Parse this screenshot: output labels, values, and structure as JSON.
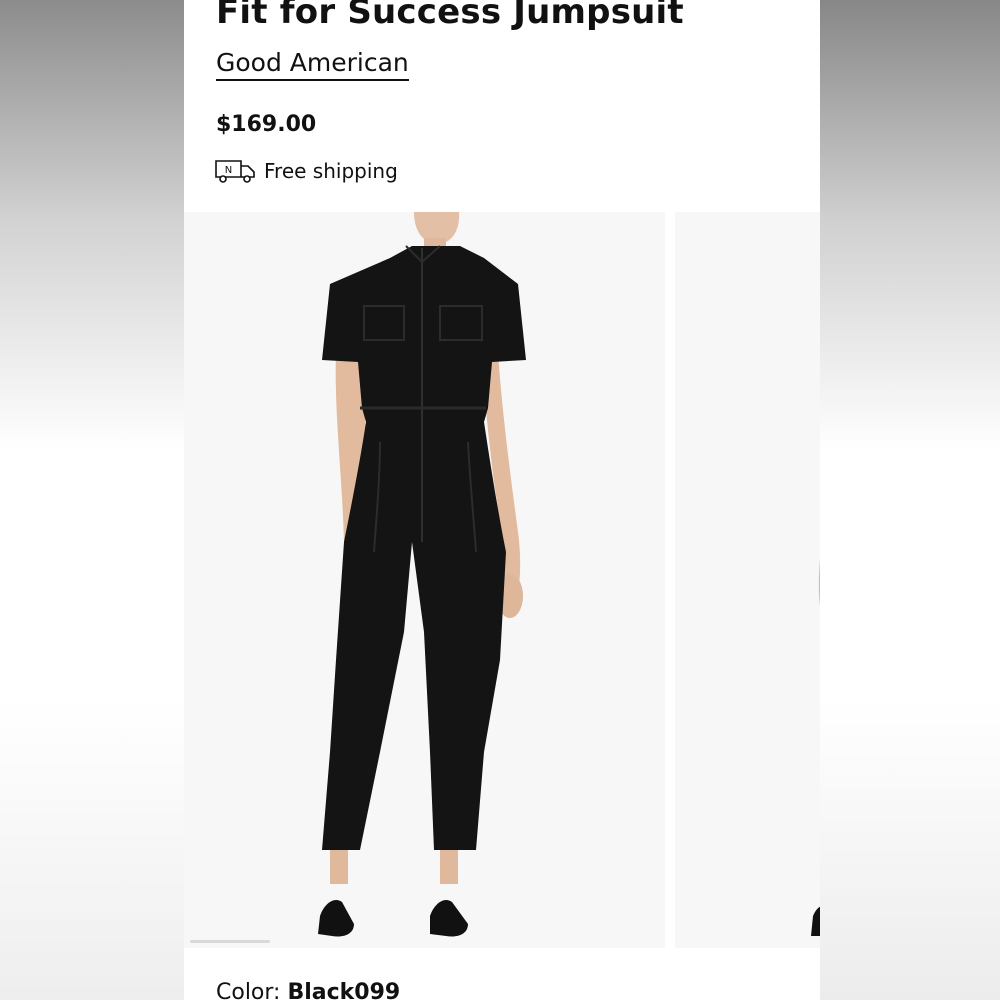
{
  "product": {
    "title": "Fit for Success Jumpsuit",
    "brand": "Good American",
    "price": "$169.00",
    "shipping_label": "Free shipping",
    "shipping_icon": "delivery-truck-icon",
    "truck_letter": "N"
  },
  "gallery": {
    "images": [
      {
        "alt": "Model wearing black denim short-sleeve jumpsuit, front view"
      },
      {
        "alt": "Model wearing black denim jumpsuit, alternate view"
      }
    ]
  },
  "color": {
    "label": "Color:",
    "value": "Black099"
  },
  "colors": {
    "text": "#111111",
    "garment": "#141414",
    "image_bg": "#f7f7f7"
  }
}
